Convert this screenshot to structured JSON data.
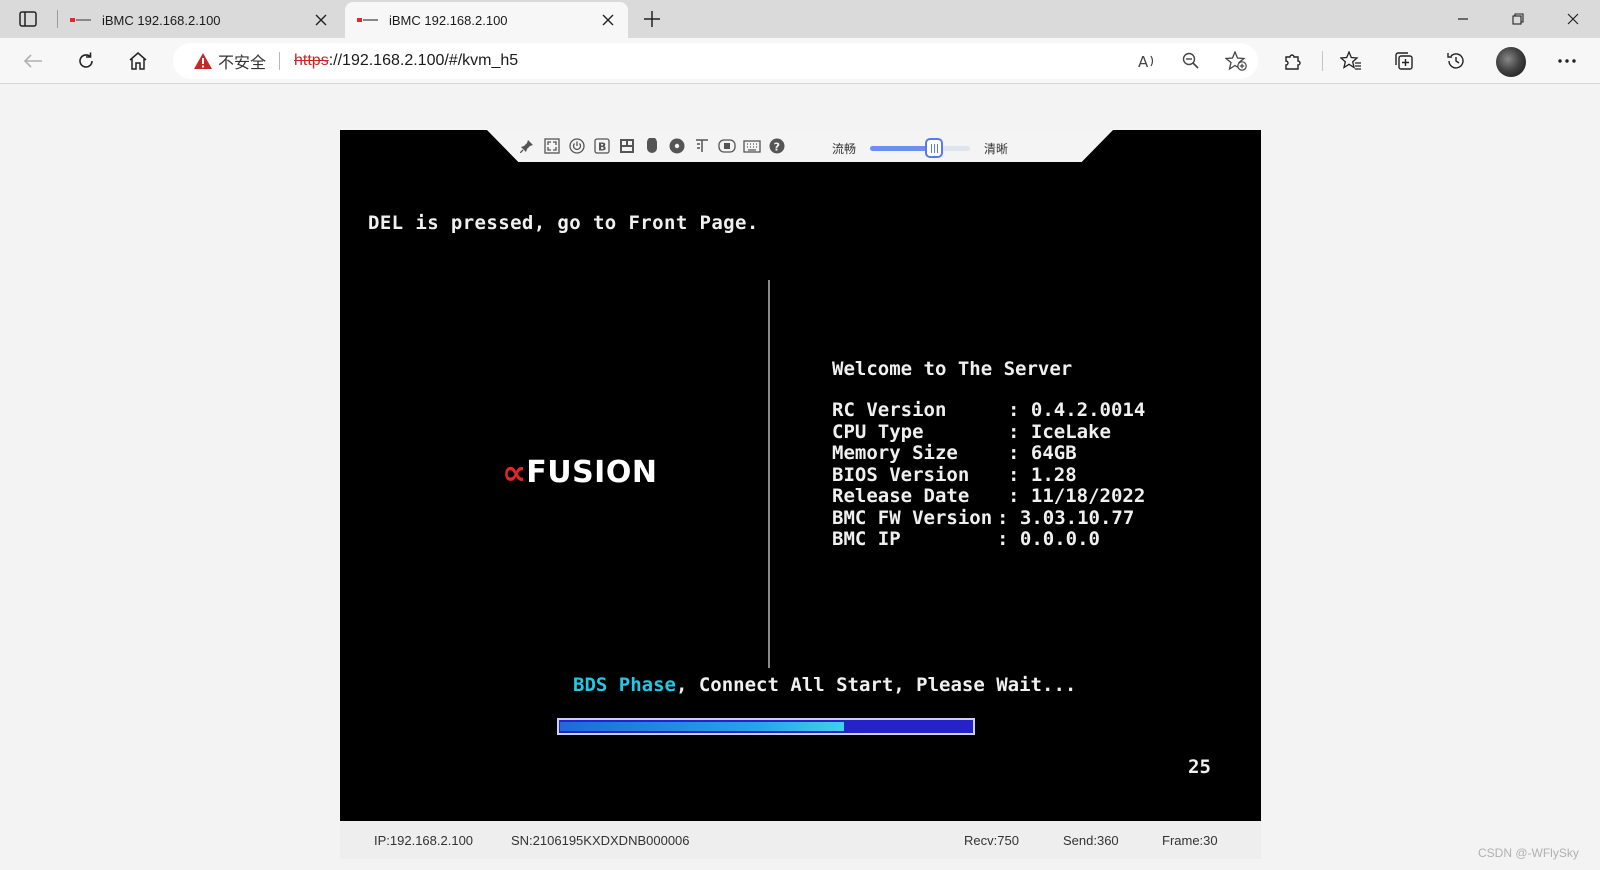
{
  "browser": {
    "tabs": [
      {
        "title": "iBMC 192.168.2.100",
        "active": false
      },
      {
        "title": "iBMC 192.168.2.100",
        "active": true
      }
    ],
    "address": {
      "security_label": "不安全",
      "protocol": "https",
      "url_rest": "://192.168.2.100/#/kvm_h5"
    }
  },
  "kvm": {
    "quality": {
      "left_label": "流畅",
      "right_label": "清晰",
      "level": 0.64
    },
    "screen": {
      "del_message": "DEL is pressed, go to Front Page.",
      "logo_mark": "∝",
      "logo_text": "FUSION",
      "welcome": "Welcome to The Server",
      "info_rows": [
        {
          "key": "RC Version",
          "value": ": 0.4.2.0014"
        },
        {
          "key": "CPU Type",
          "value": ": IceLake"
        },
        {
          "key": "Memory Size",
          "value": ": 64GB"
        },
        {
          "key": "BIOS Version",
          "value": ": 1.28"
        },
        {
          "key": "Release Date",
          "value": ": 11/18/2022"
        },
        {
          "key": "BMC FW Version",
          "value": ": 3.03.10.77"
        },
        {
          "key": "BMC IP",
          "value": ": 0.0.0.0"
        }
      ],
      "bds_highlight": "BDS Phase",
      "bds_rest": ", Connect All Start, Please Wait...",
      "progress": 0.685,
      "countdown": "25"
    },
    "status": {
      "ip": "IP:192.168.2.100",
      "sn": "SN:2106195KXDXDNB000006",
      "recv": "Recv:750",
      "send": "Send:360",
      "frame": "Frame:30"
    }
  },
  "watermark": "CSDN @-WFlySky",
  "colors": {
    "accent_red": "#e3262b",
    "bds_cyan": "#24c7e6",
    "slider_blue": "#6d8ff0",
    "progress_blue": "#2323c8"
  }
}
